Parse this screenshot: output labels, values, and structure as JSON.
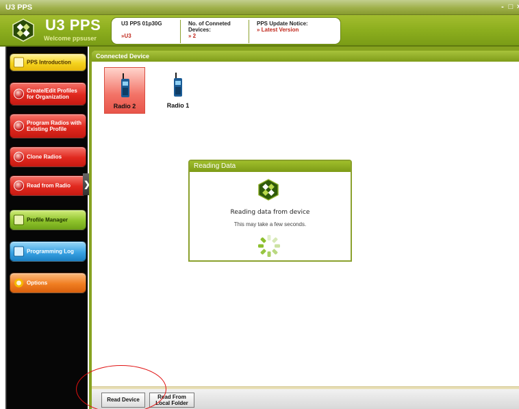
{
  "window": {
    "title": "U3 PPS",
    "controls": [
      "-",
      "□",
      "×"
    ]
  },
  "header": {
    "brand": "U3 PPS",
    "welcome": "Welcome ppsuser",
    "info": [
      {
        "label": "U3 PPS 01p30G",
        "value": "»U3"
      },
      {
        "label": "No. of Conneted Devices:",
        "value": "» 2"
      },
      {
        "label": "PPS Update Notice:",
        "value": "» Latest Version"
      }
    ]
  },
  "sidebar": {
    "items": [
      {
        "label": "PPS Introduction",
        "color": "#f5d31e"
      },
      {
        "label": "Create/Edit Profiles for Organization",
        "color": "#e0281e"
      },
      {
        "label": "Program Radios with Existing Profile",
        "color": "#e0281e"
      },
      {
        "label": "Clone Radios",
        "color": "#e0281e"
      },
      {
        "label": "Read from Radio",
        "color": "#e0281e",
        "active": true
      },
      {
        "label": "Profile Manager",
        "color": "#8fc42c"
      },
      {
        "label": "Programming Log",
        "color": "#3aa3e4"
      },
      {
        "label": "Options",
        "color": "#f07e22"
      }
    ],
    "active_arrow": "❯"
  },
  "main": {
    "section_title": "Connected Device",
    "devices": [
      {
        "label": "Radio 2",
        "selected": true
      },
      {
        "label": "Radio 1",
        "selected": false
      }
    ]
  },
  "dialog": {
    "title": "Reading Data",
    "message": "Reading data from device",
    "submessage": "This may take a few seconds."
  },
  "bottom": {
    "read_device": "Read Device",
    "read_local_line1": "Read From",
    "read_local_line2": "Local Folder"
  },
  "colors": {
    "accent": "#86a21f",
    "annotation": "#e01010"
  }
}
